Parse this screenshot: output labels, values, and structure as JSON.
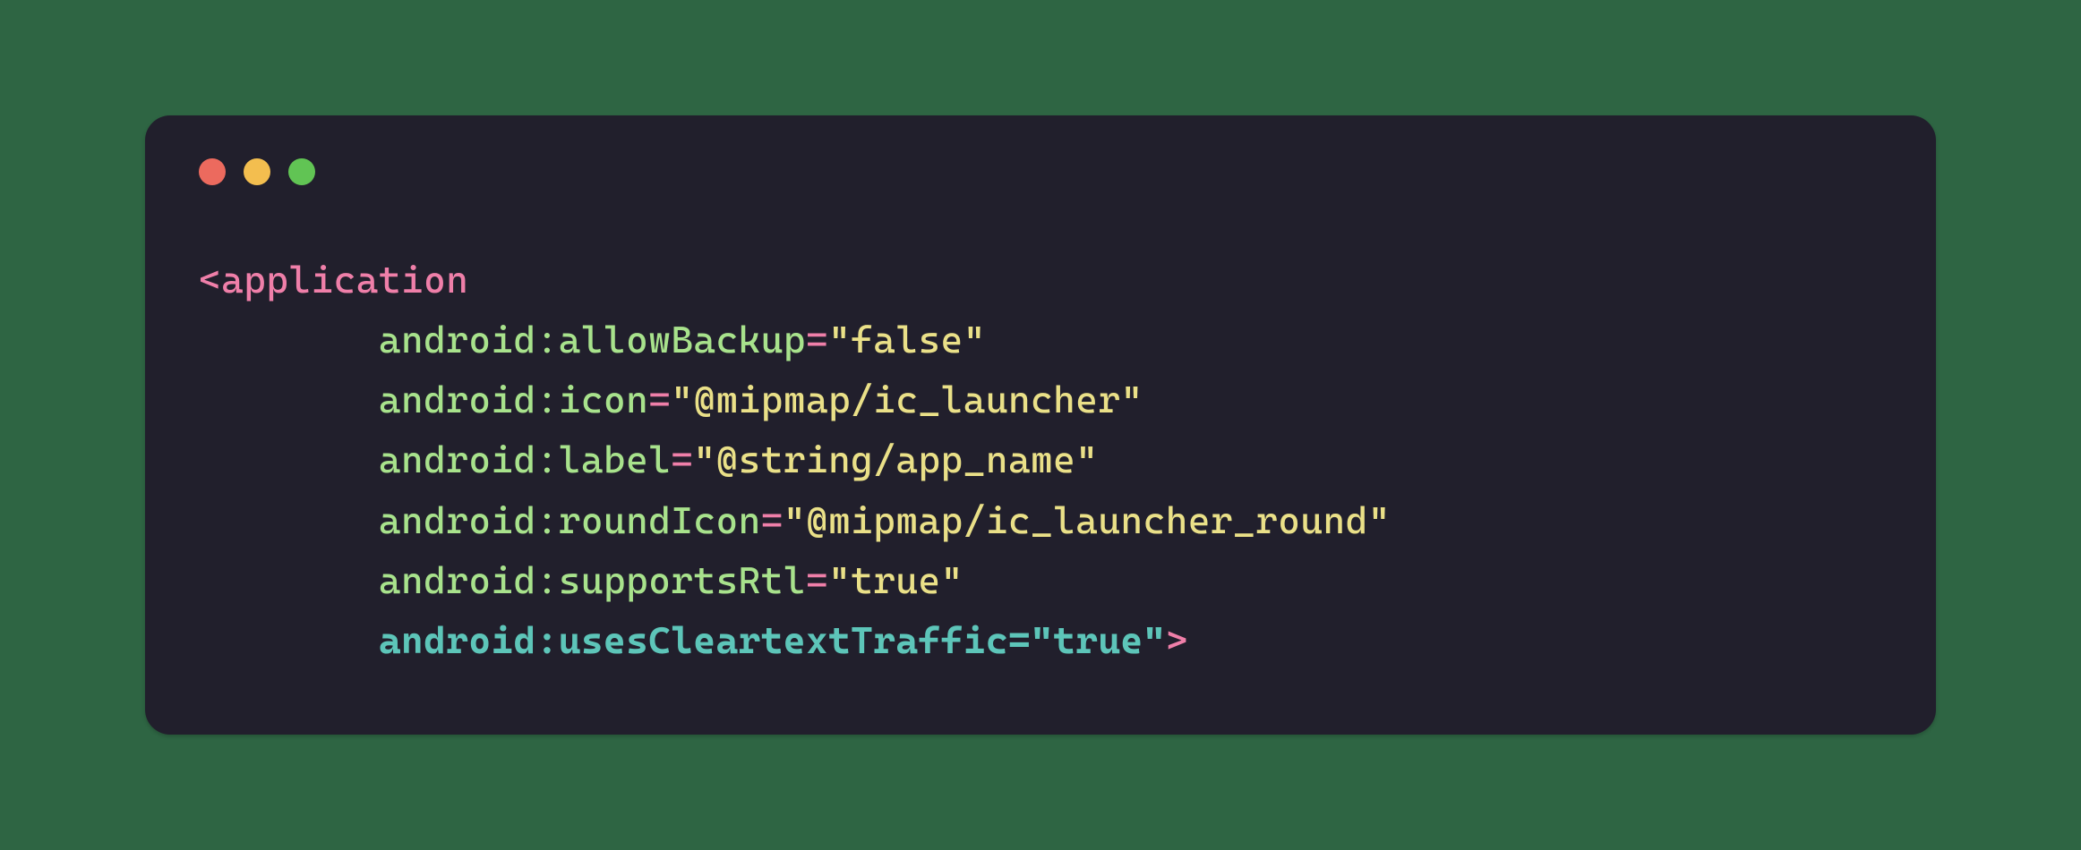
{
  "code": {
    "tag_open": "<application",
    "attrs": [
      {
        "name": "android:allowBackup",
        "eq": "=",
        "value": "\"false\""
      },
      {
        "name": "android:icon",
        "eq": "=",
        "value": "\"@mipmap/ic_launcher\""
      },
      {
        "name": "android:label",
        "eq": "=",
        "value": "\"@string/app_name\""
      },
      {
        "name": "android:roundIcon",
        "eq": "=",
        "value": "\"@mipmap/ic_launcher_round\""
      },
      {
        "name": "android:supportsRtl",
        "eq": "=",
        "value": "\"true\""
      }
    ],
    "highlight": "android:usesCleartextTraffic=\"true\"",
    "tag_close": ">"
  },
  "indent": "        "
}
